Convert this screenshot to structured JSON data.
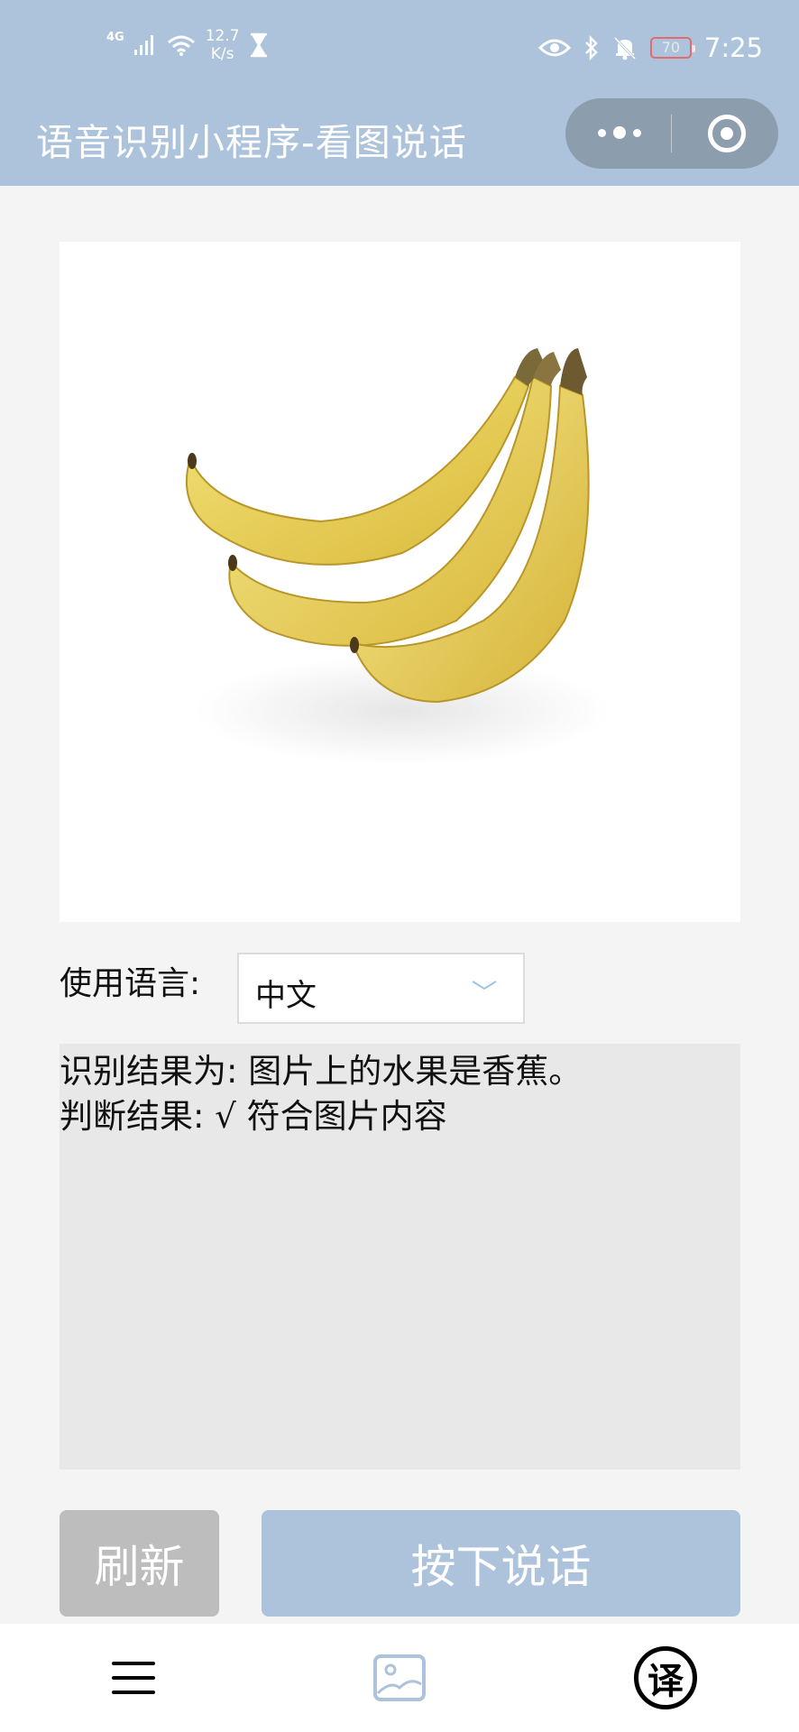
{
  "status_bar": {
    "network_type": "4G",
    "speed_value": "12.7",
    "speed_unit": "K/s",
    "battery": "70",
    "time": "7:25"
  },
  "title_bar": {
    "title": "语音识别小程序-看图说话"
  },
  "image": {
    "subject": "banana"
  },
  "language": {
    "label": "使用语言:",
    "selected": "中文"
  },
  "result": {
    "line1": "识别结果为:  图片上的水果是香蕉。",
    "line2": "判断结果: √ 符合图片内容"
  },
  "buttons": {
    "refresh": "刷新",
    "talk": "按下说话"
  },
  "bottom_nav": {
    "icons": [
      "menu-icon",
      "image-icon",
      "translate-icon"
    ],
    "translate_glyph": "译"
  },
  "colors": {
    "header_bg": "#adc3db",
    "talk_button": "#adc3db",
    "refresh_button": "#bdbdbd",
    "result_bg": "#e8e8e8"
  }
}
